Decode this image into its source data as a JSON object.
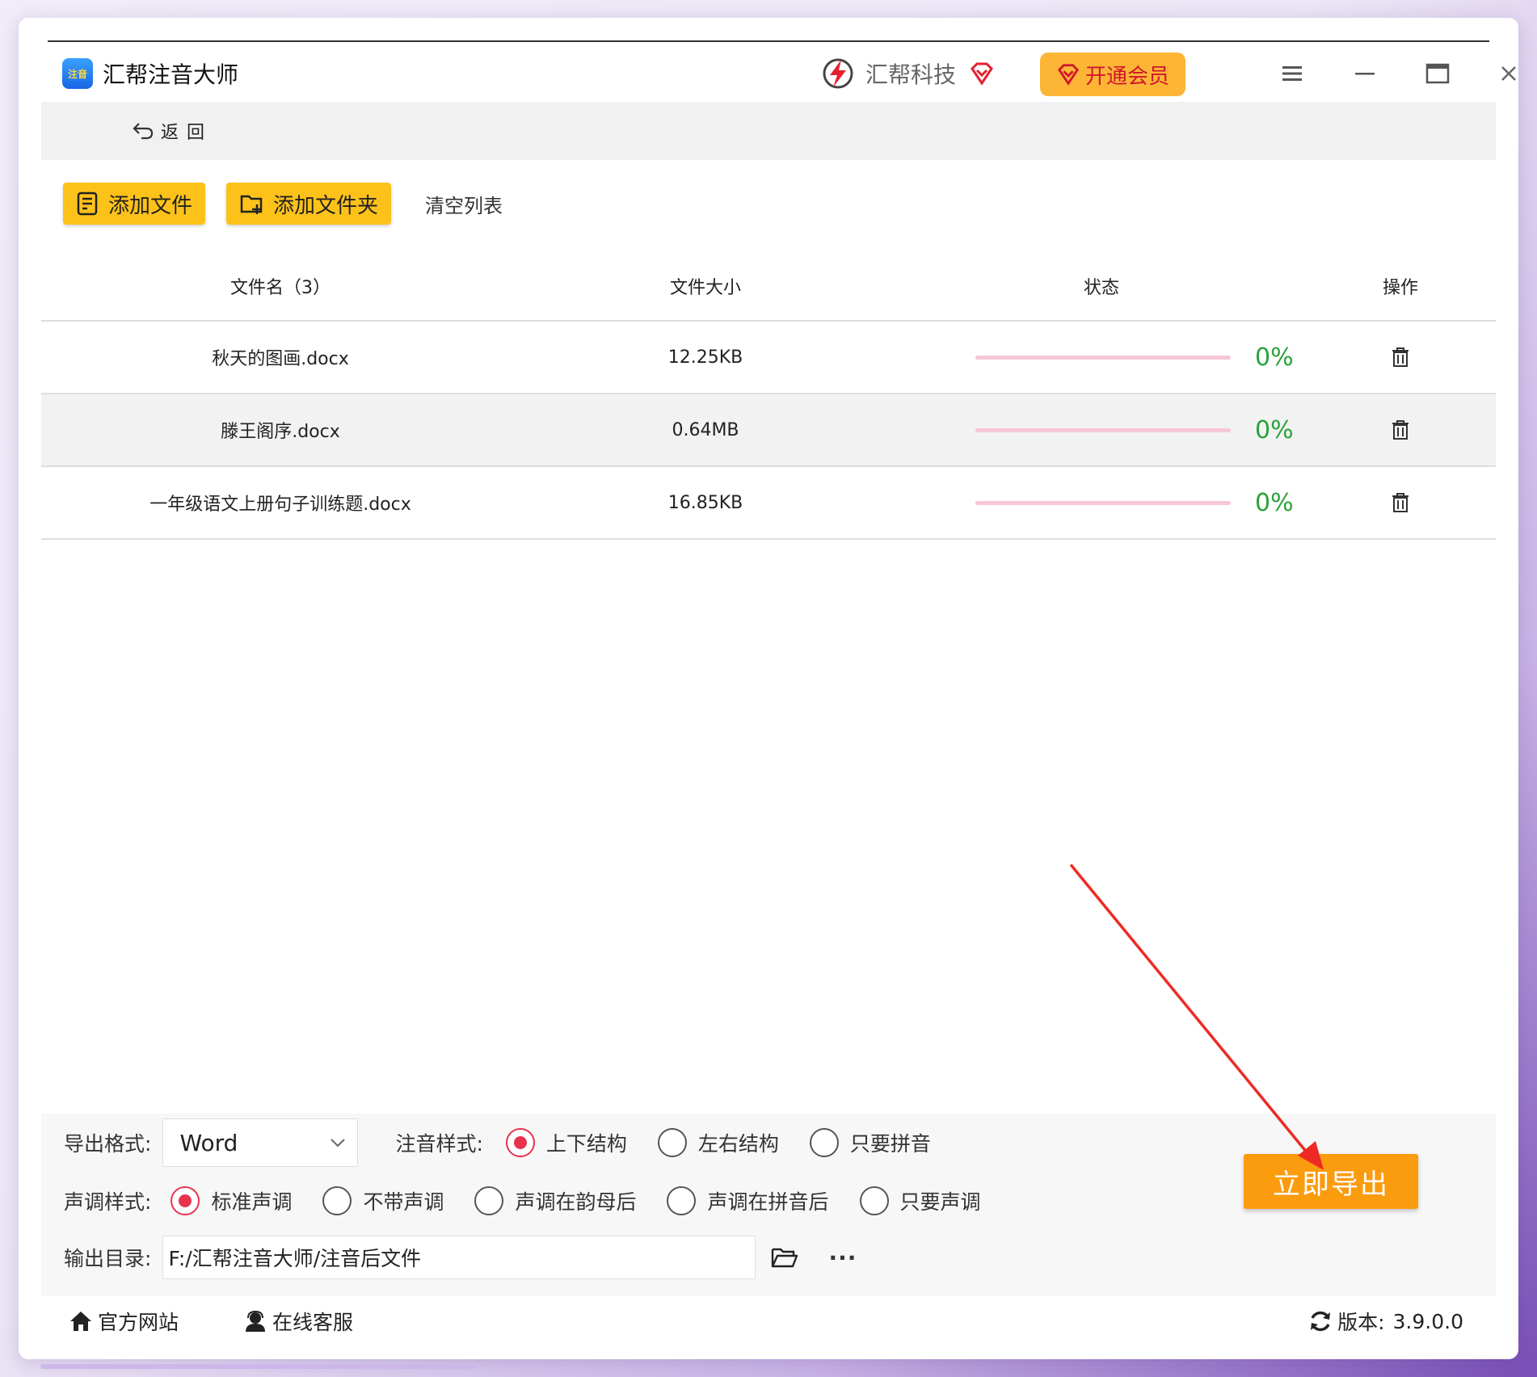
{
  "app": {
    "title": "汇帮注音大师",
    "logo_text": "注音",
    "brand_name": "汇帮科技",
    "vip_label": "开通会员"
  },
  "nav": {
    "back_label": "返回"
  },
  "toolbar": {
    "add_file": "添加文件",
    "add_folder": "添加文件夹",
    "clear_list": "清空列表"
  },
  "table": {
    "headers": {
      "name": "文件名（3）",
      "size": "文件大小",
      "status": "状态",
      "op": "操作"
    },
    "rows": [
      {
        "name": "秋天的图画.docx",
        "size": "12.25KB",
        "progress": "0%"
      },
      {
        "name": "滕王阁序.docx",
        "size": "0.64MB",
        "progress": "0%"
      },
      {
        "name": "一年级语文上册句子训练题.docx",
        "size": "16.85KB",
        "progress": "0%"
      }
    ]
  },
  "options": {
    "export_format_label": "导出格式:",
    "export_format_value": "Word",
    "pinyin_style_label": "注音样式:",
    "pinyin_styles": [
      "上下结构",
      "左右结构",
      "只要拼音"
    ],
    "pinyin_selected": "上下结构",
    "tone_style_label": "声调样式:",
    "tone_styles": [
      "标准声调",
      "不带声调",
      "声调在韵母后",
      "声调在拼音后",
      "只要声调"
    ],
    "tone_selected": "标准声调",
    "output_dir_label": "输出目录:",
    "output_dir_value": "F:/汇帮注音大师/注音后文件",
    "more_label": "···"
  },
  "export_button": "立即导出",
  "footer": {
    "website": "官方网站",
    "support": "在线客服",
    "version_label": "版本:",
    "version_value": "3.9.0.0"
  },
  "colors": {
    "accent_yellow": "#fdc21a",
    "export_orange": "#fb9b0e",
    "progress_green": "#29a33a",
    "radio_red": "#e8324e",
    "annotation_arrow": "#ee2a24"
  }
}
